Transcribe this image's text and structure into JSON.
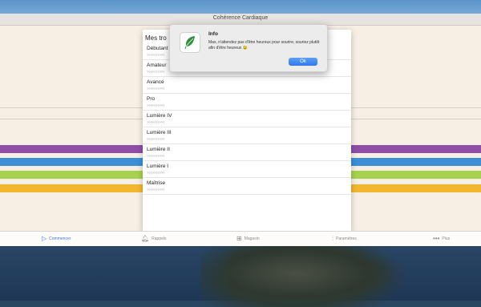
{
  "window": {
    "title": "Cohérence Cardiaque"
  },
  "colors": {
    "band_purple": "#8e4ea7",
    "band_blue": "#3a8fd6",
    "band_green": "#a6d24f",
    "band_yellow": "#f2b72f",
    "accent": "#3a78d8"
  },
  "list": {
    "title": "Mes tro",
    "rows": [
      {
        "name": "Débutant",
        "sub": "??????????"
      },
      {
        "name": "Amateur",
        "sub": "??????????"
      },
      {
        "name": "Avancé",
        "sub": "??????????"
      },
      {
        "name": "Pro",
        "sub": "??????????"
      },
      {
        "name": "Lumière IV",
        "sub": "??????????"
      },
      {
        "name": "Lumière III",
        "sub": "??????????"
      },
      {
        "name": "Lumière II",
        "sub": "??????????"
      },
      {
        "name": "Lumière I",
        "sub": "??????????"
      },
      {
        "name": "Maîtrise",
        "sub": "??????????"
      }
    ]
  },
  "alert": {
    "title": "Info",
    "message": "Max, n'attendez pas d'être heureux pour sourire, souriez plutôt afin d'être heureux 😉",
    "ok_label": "Ok"
  },
  "tabbar": {
    "tabs": [
      {
        "label": "Commencer",
        "icon": "play-icon",
        "active": true
      },
      {
        "label": "Rappels",
        "icon": "bell-icon",
        "active": false
      },
      {
        "label": "Magasin",
        "icon": "cart-icon",
        "active": false
      },
      {
        "label": "Paramètres",
        "icon": "sliders-icon",
        "active": false
      },
      {
        "label": "Plus",
        "icon": "more-icon",
        "active": false
      }
    ]
  }
}
